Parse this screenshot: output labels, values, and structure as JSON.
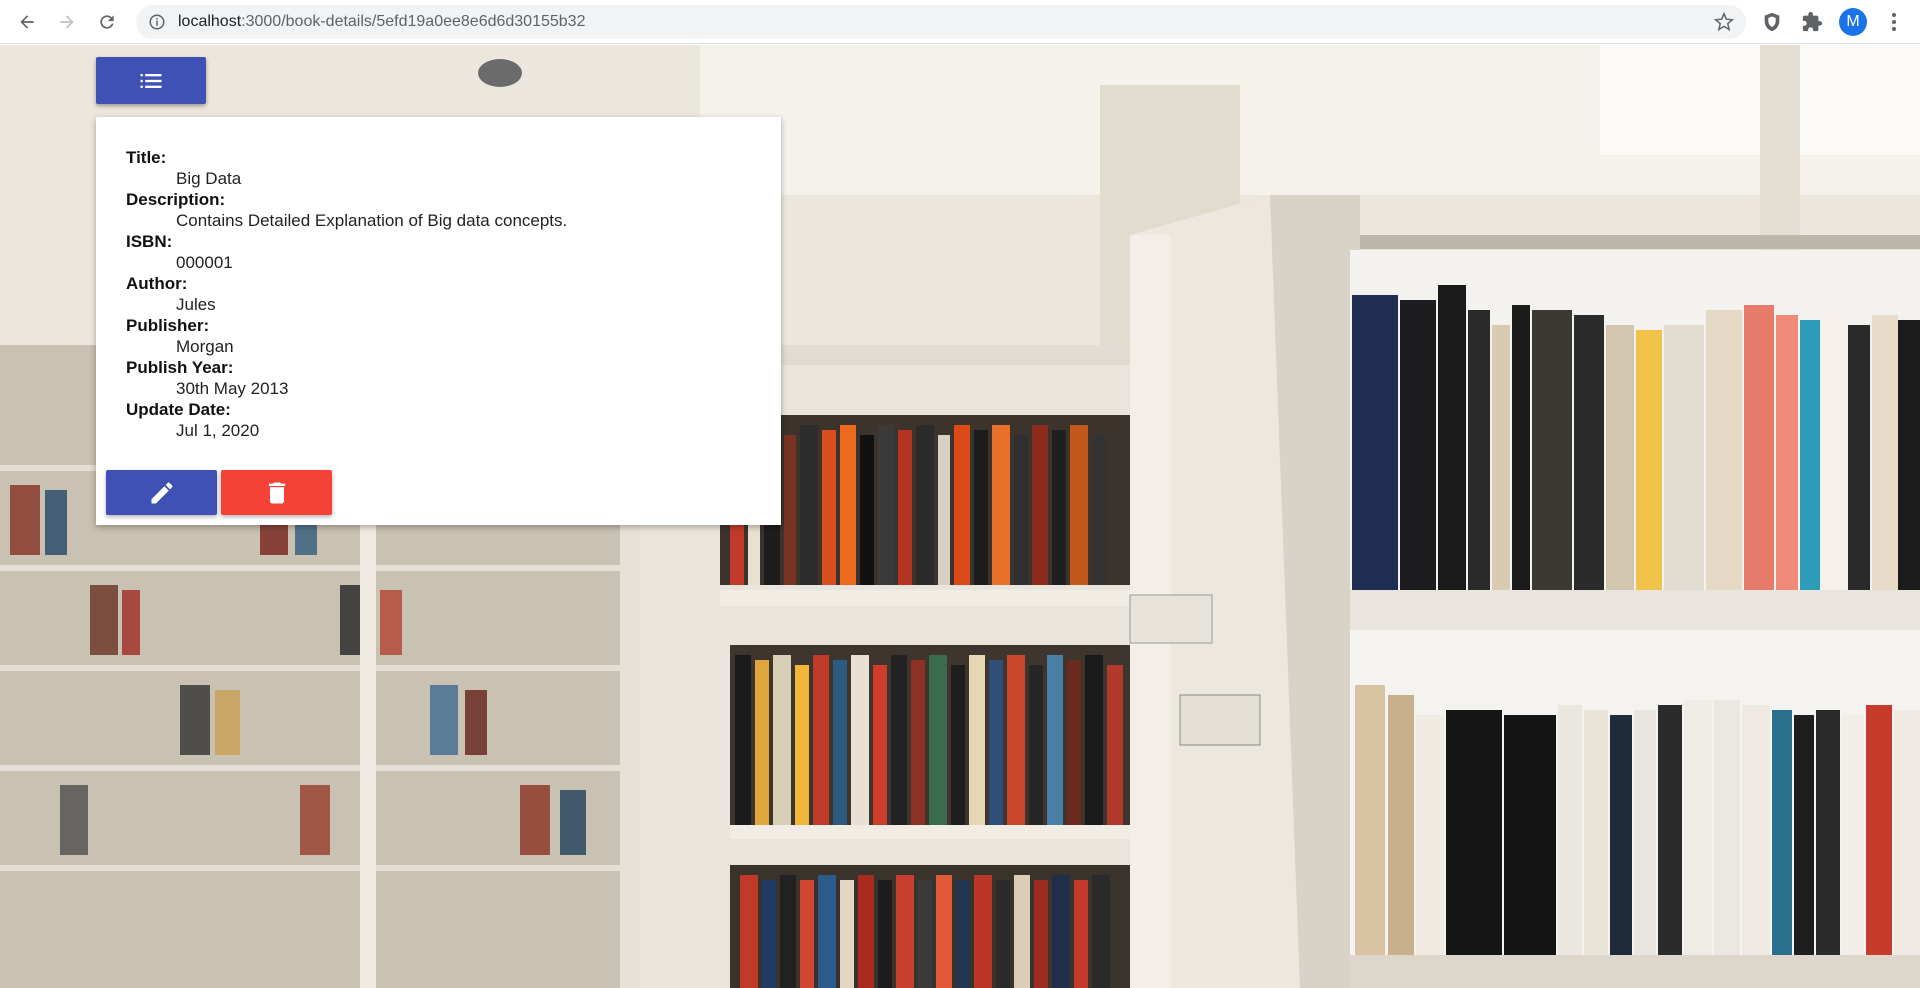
{
  "browser": {
    "url_host": "localhost",
    "url_path": ":3000/book-details/5efd19a0ee8e6d6d30155b32",
    "avatar_initial": "M"
  },
  "book": {
    "fields": [
      {
        "label": "Title:",
        "value": "Big Data"
      },
      {
        "label": "Description:",
        "value": "Contains Detailed Explanation of Big data concepts."
      },
      {
        "label": "ISBN:",
        "value": "000001"
      },
      {
        "label": "Author:",
        "value": "Jules"
      },
      {
        "label": "Publisher:",
        "value": "Morgan"
      },
      {
        "label": "Publish Year:",
        "value": "30th May 2013"
      },
      {
        "label": "Update Date:",
        "value": "Jul 1, 2020"
      }
    ]
  },
  "icons": {
    "menu": "list-icon",
    "edit": "pencil-icon",
    "delete": "trash-icon"
  },
  "colors": {
    "primary": "#3f51b5",
    "danger": "#f44336"
  }
}
